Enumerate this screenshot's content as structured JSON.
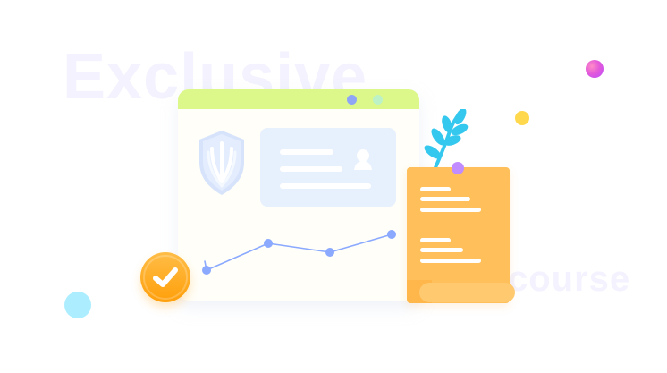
{
  "watermarks": {
    "left": "Exclusive",
    "right": "course"
  },
  "icons": {
    "shield": "shield-icon",
    "avatar": "user-icon",
    "check": "check-icon",
    "plant": "plant-icon",
    "scroll": "document-scroll-icon"
  },
  "chart_data": {
    "type": "line",
    "values": [
      1,
      2.5,
      2,
      3
    ],
    "x": [
      1,
      2,
      3,
      4
    ],
    "grid": false,
    "legend": "none",
    "title": "",
    "xlabel": "",
    "ylabel": "",
    "line_color": "#8aa9ff",
    "point_color": "#8aa9ff"
  },
  "colors": {
    "window_header": "#dcf88b",
    "window_body": "#fffef8",
    "card": "#e7f0fd",
    "shield": "#d6e3fb",
    "check_badge": "#ff9f0a",
    "scroll": "#ffbf5a",
    "plant": "#35c8ef",
    "watermark": "#f3f2fe",
    "dot_magenta": "#e45ad9",
    "dot_yellow": "#ffd84d",
    "dot_cyan": "#a3ecff",
    "dot_purple": "#c08cff"
  }
}
